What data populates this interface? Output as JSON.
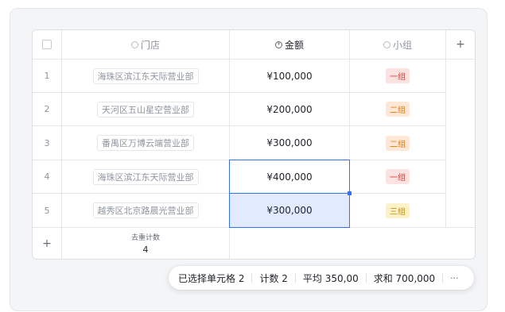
{
  "table": {
    "columns": [
      {
        "label": "门店",
        "icon": "circle-field-icon"
      },
      {
        "label": "金额",
        "icon": "currency-field-icon"
      },
      {
        "label": "小组",
        "icon": "circle-field-icon"
      }
    ],
    "add_column": "+",
    "rows": [
      {
        "num": "1",
        "store": "海珠区滨江东天际营业部",
        "amount": "¥100,000",
        "group": "一组"
      },
      {
        "num": "2",
        "store": "天河区五山星空营业部",
        "amount": "¥200,000",
        "group": "二组"
      },
      {
        "num": "3",
        "store": "番禺区万博云端营业部",
        "amount": "¥300,000",
        "group": "二组"
      },
      {
        "num": "4",
        "store": "海珠区滨江东天际营业部",
        "amount": "¥400,000",
        "group": "一组"
      },
      {
        "num": "5",
        "store": "越秀区北京路晨光营业部",
        "amount": "¥300,000",
        "group": "三组"
      }
    ],
    "footer": {
      "add_row": "+",
      "label": "去重计数",
      "value": "4"
    }
  },
  "tag_colors": {
    "一组": {
      "bg": "#fde2e2",
      "fg": "#d83931"
    },
    "二组": {
      "bg": "#fee7d6",
      "fg": "#de7802"
    },
    "三组": {
      "bg": "#fdf1c8",
      "fg": "#c08b00"
    }
  },
  "statusbar": {
    "selected": "已选择单元格 2",
    "count": "计数 2",
    "average": "平均 350,00",
    "sum": "求和 700,000",
    "more": "···"
  }
}
